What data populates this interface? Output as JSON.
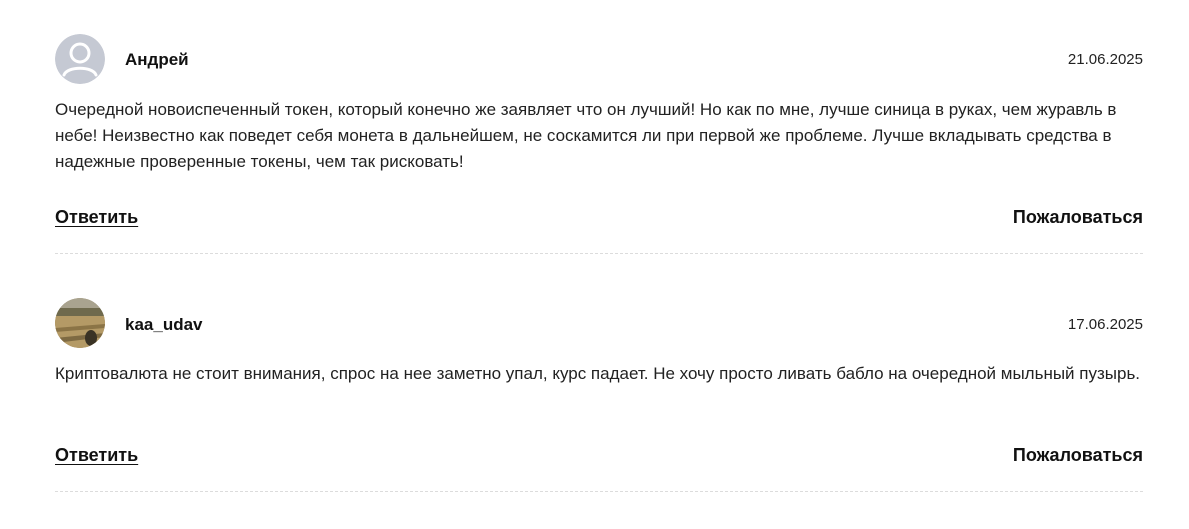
{
  "comments": [
    {
      "author": "Андрей",
      "date": "21.06.2025",
      "avatar_icon": "default-user-icon",
      "text": "Очередной новоиспеченный токен, который конечно же заявляет что он лучший! Но как по мне, лучше синица в руках, чем журавль в небе! Неизвестно как поведет себя монета в дальнейшем, не соскамится ли при первой же проблеме. Лучше вкладывать средства в надежные проверенные токены, чем так рисковать!",
      "reply_label": "Ответить",
      "report_label": "Пожаловаться"
    },
    {
      "author": "kaa_udav",
      "date": "17.06.2025",
      "avatar_icon": "photo-avatar",
      "text": "Криптовалюта не стоит внимания, спрос на нее заметно упал, курс падает. Не хочу просто ливать бабло на очередной мыльный пузырь.",
      "reply_label": "Ответить",
      "report_label": "Пожаловаться"
    }
  ],
  "colors": {
    "avatar_placeholder_bg": "#c5c9d3",
    "avatar_placeholder_fg": "#ffffff",
    "divider": "#dcdcdc",
    "text": "#222222"
  }
}
